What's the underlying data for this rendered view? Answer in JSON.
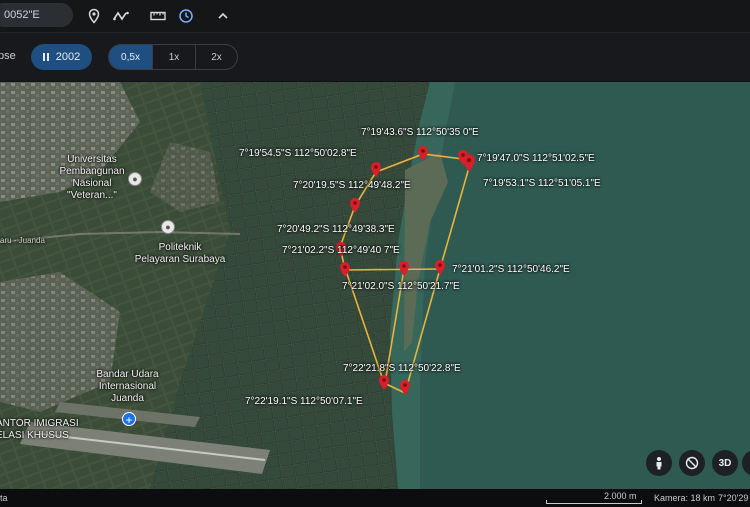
{
  "toolbar": {
    "coordinate_text": "0052\"E",
    "icons": [
      "pin-icon",
      "path-icon",
      "ruler-icon",
      "history-icon",
      "chevron-up-icon"
    ]
  },
  "timelapse": {
    "label": "pse",
    "year": "2002",
    "speeds": [
      "0,5x",
      "1x",
      "2x"
    ],
    "active_speed": "0,5x"
  },
  "map": {
    "places": [
      {
        "name": "Universitas\nPembangunan\nNasional\n\"Veteran...\"",
        "icon": "school-icon"
      },
      {
        "name": "Politeknik\nPelayaran Surabaya",
        "icon": "school-icon"
      },
      {
        "name": "Bandar Udara\nInternasional\nJuanda",
        "icon": "airport-icon"
      },
      {
        "name": "ANTOR IMIGRASI\nELASI KHUSUS",
        "icon": "none"
      },
      {
        "name": "aru - Juanda",
        "icon": "road-label"
      }
    ],
    "coordinates": [
      "7°19'43.6\"S 112°50'35 0\"E",
      "7°19'54.5\"S 112°50'02.8\"E",
      "7°19'47.0\"S 112°51'02.5\"E",
      "7°19'53.1\"S 112°51'05.1\"E",
      "7°20'19.5\"S 112°49'48.2\"E",
      "7°20'49.2\"S 112°49'38.3\"E",
      "7°21'02.2\"S 112°49'40 7\"E",
      "7°21'01.2\"S 112°50'46.2\"E",
      "7°21'02.0\"S 112°50'21.7\"E",
      "7°22'21.8\"S 112°50'22.8\"E",
      "7°22'19.1\"S 112°50'07.1\"E"
    ],
    "colors": {
      "path": "#e8b43a",
      "pin": "#d81f2a",
      "sea": "#2f5a52",
      "land": "#34463a"
    },
    "controls": [
      "pegman-icon",
      "compass-reset-icon",
      "3D"
    ]
  },
  "status": {
    "left_text": "ta",
    "scale": "2.000 m",
    "camera": "Kamera: 18 km",
    "coords": "7°20'29"
  }
}
